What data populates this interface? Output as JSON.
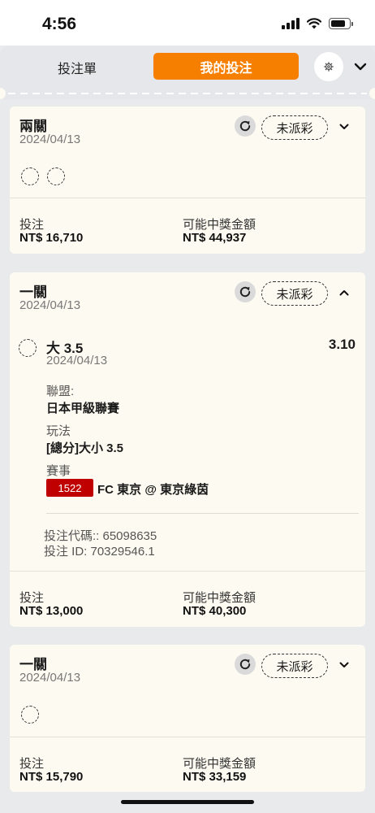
{
  "status_bar": {
    "time": "4:56"
  },
  "header": {
    "tabs": [
      {
        "label": "投注單",
        "active": false
      },
      {
        "label": "我的投注",
        "active": true
      }
    ],
    "accent_color": "#f77f00",
    "icons": [
      "gear-icon",
      "chevron-down-icon"
    ]
  },
  "bets": [
    {
      "title": "兩關",
      "date": "2024/04/13",
      "status": "未派彩",
      "expanded": false,
      "stake_label": "投注",
      "stake_value": "NT$ 16,710",
      "payout_label": "可能中獎金額",
      "payout_value": "NT$ 44,937"
    },
    {
      "title": "一關",
      "date": "2024/04/13",
      "status": "未派彩",
      "expanded": true,
      "leg": {
        "selection": "大 3.5",
        "odds": "3.10",
        "date": "2024/04/13",
        "league_label": "聯盟:",
        "league_value": "日本甲級聯賽",
        "market_label": "玩法",
        "market_value": "[總分]大小 3.5",
        "event_label": "賽事",
        "event_code": "1522",
        "event_name": "FC 東京 @ 東京綠茵"
      },
      "bet_code": "投注代碼:: 65098635",
      "bet_id": "投注 ID: 70329546.1",
      "stake_label": "投注",
      "stake_value": "NT$ 13,000",
      "payout_label": "可能中獎金額",
      "payout_value": "NT$ 40,300"
    },
    {
      "title": "一關",
      "date": "2024/04/13",
      "status": "未派彩",
      "expanded": false,
      "stake_label": "投注",
      "stake_value": "NT$ 15,790",
      "payout_label": "可能中獎金額",
      "payout_value": "NT$ 33,159"
    }
  ],
  "colors": {
    "event_badge": "#c00000",
    "card_bg": "#fdfbf1",
    "page_bg": "#e9eaec"
  }
}
